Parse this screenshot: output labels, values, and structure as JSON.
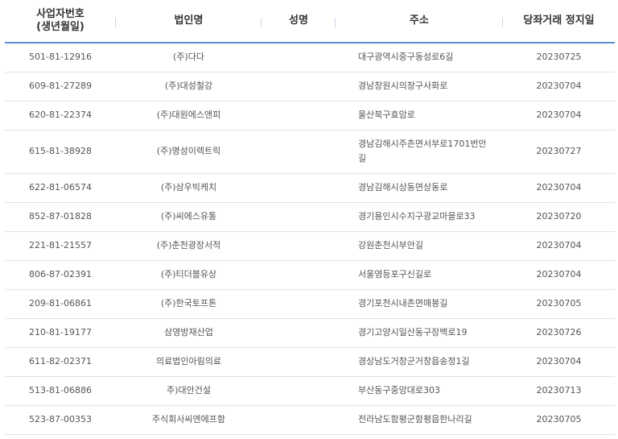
{
  "headers": {
    "biz_no_line1": "사업자번호",
    "biz_no_line2": "(생년월일)",
    "corp_name": "법인명",
    "person_name": "성명",
    "address": "주소",
    "stop_date": "당좌거래 정지일"
  },
  "rows": [
    {
      "biz_no": "501-81-12916",
      "corp_name": "(주)다다",
      "person_name": "",
      "address": "대구광역시중구동성로6길",
      "stop_date": "20230725"
    },
    {
      "biz_no": "609-81-27289",
      "corp_name": "(주)대성철강",
      "person_name": "",
      "address": "경남창원시의창구사화로",
      "stop_date": "20230704"
    },
    {
      "biz_no": "620-81-22374",
      "corp_name": "(주)대원에스앤피",
      "person_name": "",
      "address": "울산북구효암로",
      "stop_date": "20230704"
    },
    {
      "biz_no": "615-81-38928",
      "corp_name": "(주)명성이렉트릭",
      "person_name": "",
      "address": "경남김해시주촌면서부로1701번안길",
      "stop_date": "20230727"
    },
    {
      "biz_no": "622-81-06574",
      "corp_name": "(주)삼우빅케치",
      "person_name": "",
      "address": "경남김해시상동면상동로",
      "stop_date": "20230704"
    },
    {
      "biz_no": "852-87-01828",
      "corp_name": "(주)씨에스유통",
      "person_name": "",
      "address": "경기용인시수지구광교마을로33",
      "stop_date": "20230720"
    },
    {
      "biz_no": "221-81-21557",
      "corp_name": "(주)춘천광장서적",
      "person_name": "",
      "address": "강원춘천시부안길",
      "stop_date": "20230704"
    },
    {
      "biz_no": "806-87-02391",
      "corp_name": "(주)티더블유상",
      "person_name": "",
      "address": "서울영등포구신길로",
      "stop_date": "20230704"
    },
    {
      "biz_no": "209-81-06861",
      "corp_name": "(주)한국토프톤",
      "person_name": "",
      "address": "경기포천시내촌면매봉길",
      "stop_date": "20230705"
    },
    {
      "biz_no": "210-81-19177",
      "corp_name": "삼영방재산업",
      "person_name": "",
      "address": "경기고양시일산동구장백로19",
      "stop_date": "20230726"
    },
    {
      "biz_no": "611-82-02371",
      "corp_name": "의료법인아림의료",
      "person_name": "",
      "address": "경상남도거창군거창읍송정1길",
      "stop_date": "20230704"
    },
    {
      "biz_no": "513-81-06886",
      "corp_name": "주)대안건설",
      "person_name": "",
      "address": "부산동구중앙대로303",
      "stop_date": "20230713"
    },
    {
      "biz_no": "523-87-00353",
      "corp_name": "주식회사씨엔에프함",
      "person_name": "",
      "address": "전라남도함평군함평읍한나리길",
      "stop_date": "20230705"
    }
  ]
}
